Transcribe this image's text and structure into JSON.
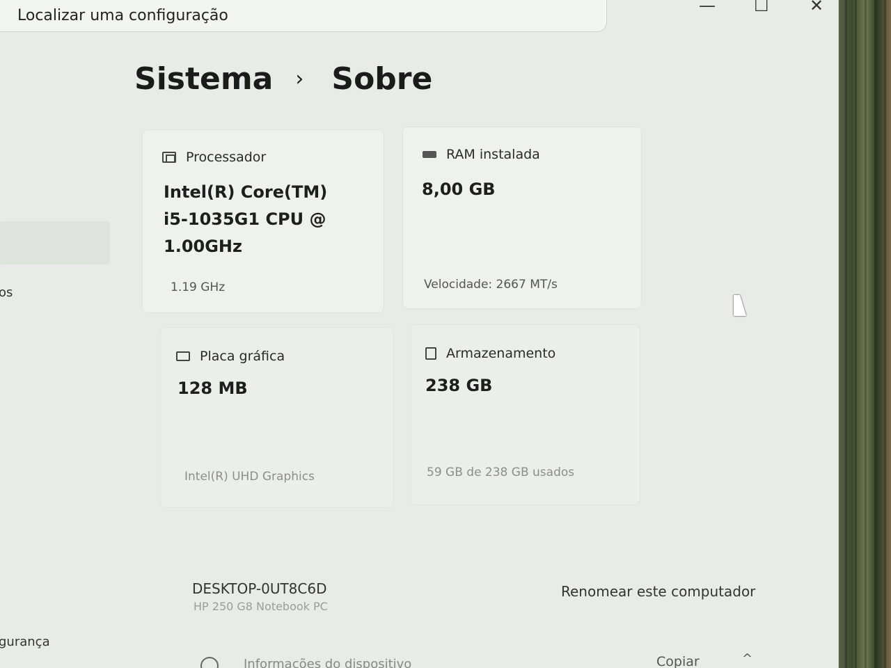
{
  "search": {
    "placeholder": "Localizar uma configuração"
  },
  "window_controls": {
    "minimize": "—",
    "maximize": "☐",
    "close": "✕"
  },
  "sidebar": {
    "partial_item_1": "os",
    "partial_item_2": "gurança"
  },
  "breadcrumb": {
    "parent": "Sistema",
    "separator": "›",
    "current": "Sobre"
  },
  "specs": {
    "processor": {
      "label": "Processador",
      "value_lines": [
        "Intel(R) Core(TM)",
        "i5-1035G1 CPU @",
        "1.00GHz"
      ],
      "detail": "1.19 GHz"
    },
    "ram": {
      "label": "RAM instalada",
      "value": "8,00 GB",
      "detail": "Velocidade: 2667 MT/s"
    },
    "gpu": {
      "label": "Placa gráfica",
      "value": "128 MB",
      "detail": "Intel(R) UHD Graphics"
    },
    "storage": {
      "label": "Armazenamento",
      "value": "238 GB",
      "detail": "59 GB de 238 GB usados"
    }
  },
  "device": {
    "name": "DESKTOP-0UT8C6D",
    "model": "HP 250 G8 Notebook PC",
    "rename_label": "Renomear este computador"
  },
  "footer": {
    "info_label": "Informações do dispositivo",
    "copy_label": "Copiar",
    "collapse_icon": "^"
  }
}
